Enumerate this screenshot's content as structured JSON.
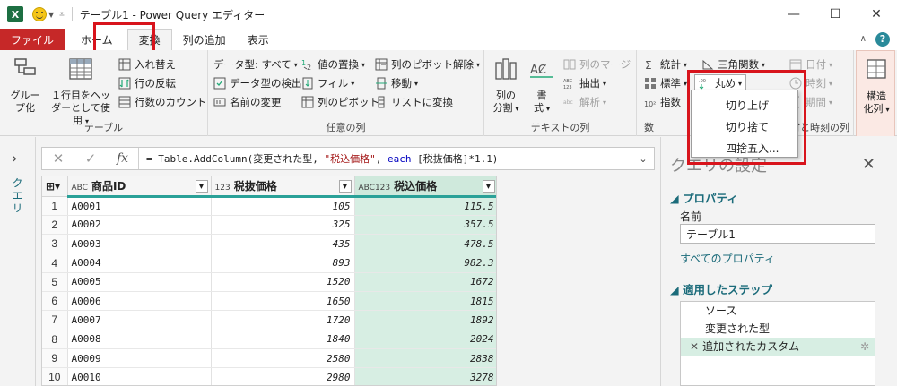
{
  "titlebar": {
    "app_icon": "X",
    "title": "テーブル1 - Power Query エディター",
    "minimize": "—",
    "maximize": "☐",
    "close": "✕"
  },
  "tabs": [
    {
      "label": "ファイル"
    },
    {
      "label": "ホーム"
    },
    {
      "label": "変換"
    },
    {
      "label": "列の追加"
    },
    {
      "label": "表示"
    }
  ],
  "help": "?",
  "ribbon": {
    "table_group": {
      "label": "テーブル",
      "group_by": "グループ化",
      "group_by_l1": "グルー",
      "group_by_l2": "プ化",
      "use_first_row_l1": "１行目をヘッ",
      "use_first_row_l2": "ダーとして使用",
      "transpose": "入れ替え",
      "reverse_rows": "行の反転",
      "count_rows": "行数のカウント"
    },
    "any_column_group": {
      "label": "任意の列",
      "data_type": "データ型: すべて",
      "detect_type": "データ型の検出",
      "rename": "名前の変更",
      "replace_values": "値の置換",
      "fill": "フィル",
      "pivot": "列のピボット",
      "unpivot": "列のピボット解除",
      "move": "移動",
      "to_list": "リストに変換"
    },
    "text_group": {
      "label": "テキストの列",
      "split_l1": "列の",
      "split_l2": "分割",
      "format_l1": "書",
      "format_l2": "式",
      "merge": "列のマージ",
      "extract": "抽出",
      "parse": "解析"
    },
    "number_group": {
      "label": "数",
      "stats": "統計",
      "standard": "標準",
      "scientific": "指数",
      "trig": "三角関数",
      "rounding": "丸め"
    },
    "datetime_group": {
      "label": "日付と時刻の列",
      "date": "日付",
      "time": "時刻",
      "duration": "期間"
    },
    "structured_group": {
      "label_l1": "構造",
      "label_l2": "化列"
    }
  },
  "rounding_menu": {
    "items": [
      "切り上げ",
      "切り捨て",
      "四捨五入..."
    ]
  },
  "leftnav": {
    "label": "クエリ"
  },
  "formula": {
    "cancel": "✕",
    "confirm": "✓",
    "fx": "fx",
    "text_pre": "= Table.AddColumn(変更された型, ",
    "text_str": "\"税込価格\"",
    "text_mid": ", ",
    "text_kw": "each",
    "text_post": " [税抜価格]*1.1)"
  },
  "grid": {
    "columns": [
      {
        "type": "ABC",
        "name": "商品ID"
      },
      {
        "type": "123",
        "name": "税抜価格"
      },
      {
        "type": "ABC123",
        "name": "税込価格"
      }
    ],
    "rows": [
      [
        "1",
        "A0001",
        "105",
        "115.5"
      ],
      [
        "2",
        "A0002",
        "325",
        "357.5"
      ],
      [
        "3",
        "A0003",
        "435",
        "478.5"
      ],
      [
        "4",
        "A0004",
        "893",
        "982.3"
      ],
      [
        "5",
        "A0005",
        "1520",
        "1672"
      ],
      [
        "6",
        "A0006",
        "1650",
        "1815"
      ],
      [
        "7",
        "A0007",
        "1720",
        "1892"
      ],
      [
        "8",
        "A0008",
        "1840",
        "2024"
      ],
      [
        "9",
        "A0009",
        "2580",
        "2838"
      ],
      [
        "10",
        "A0010",
        "2980",
        "3278"
      ]
    ]
  },
  "query_settings": {
    "title": "クエリの設定",
    "properties_heading": "プロパティ",
    "name_label": "名前",
    "name_value": "テーブル1",
    "all_properties": "すべてのプロパティ",
    "steps_heading": "適用したステップ",
    "steps": [
      "ソース",
      "変更された型",
      "追加されたカスタム"
    ]
  },
  "colors": {
    "accent": "#2aa198",
    "highlight_frame": "#d8141c",
    "file_tab": "#c62828",
    "new_column": "#d7eee3"
  }
}
